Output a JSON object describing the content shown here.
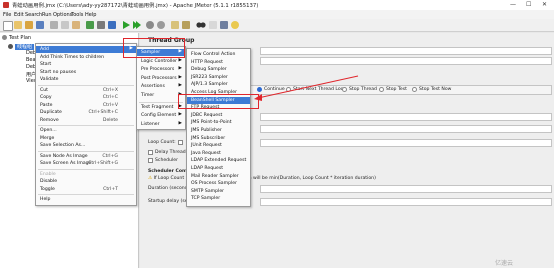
{
  "window": {
    "title": "青蛙动画用例.jmx (C:\\Users\\ady-yy287172\\青蛙动画用例.jmx) - Apache JMeter (5.1.1 r1855137)",
    "minimize": "—",
    "maximize": "☐",
    "close": "✕"
  },
  "menubar": [
    "File",
    "Edit",
    "Search",
    "Run",
    "Options",
    "Tools",
    "Help"
  ],
  "tree": {
    "root": "Test Plan",
    "group": "线程组",
    "children": [
      "Deb",
      "Bea",
      "Deb",
      "用户",
      "View"
    ]
  },
  "thread_group_tab": "Thread Group",
  "context_menu": {
    "items": [
      {
        "label": "Add",
        "shortcut": "",
        "arrow": true,
        "highlighted": true
      },
      {
        "label": "Add Think Times to children",
        "shortcut": ""
      },
      {
        "label": "Start",
        "shortcut": ""
      },
      {
        "label": "Start no pauses",
        "shortcut": ""
      },
      {
        "label": "Validate",
        "shortcut": ""
      },
      {
        "label": "Cut",
        "shortcut": "Ctrl+X"
      },
      {
        "label": "Copy",
        "shortcut": "Ctrl+C"
      },
      {
        "label": "Paste",
        "shortcut": "Ctrl+V"
      },
      {
        "label": "Duplicate",
        "shortcut": "Ctrl+Shift+C"
      },
      {
        "label": "Remove",
        "shortcut": "Delete"
      },
      {
        "label": "Open...",
        "shortcut": ""
      },
      {
        "label": "Merge",
        "shortcut": ""
      },
      {
        "label": "Save Selection As...",
        "shortcut": ""
      },
      {
        "label": "Save Node As Image",
        "shortcut": "Ctrl+G"
      },
      {
        "label": "Save Screen As Image",
        "shortcut": "Ctrl+Shift+G"
      },
      {
        "label": "Enable",
        "shortcut": "",
        "disabled": true
      },
      {
        "label": "Disable",
        "shortcut": ""
      },
      {
        "label": "Toggle",
        "shortcut": "Ctrl+T"
      },
      {
        "label": "Help",
        "shortcut": ""
      }
    ]
  },
  "add_submenu": {
    "items": [
      {
        "label": "Sampler",
        "highlighted": true
      },
      {
        "label": "Logic Controller"
      },
      {
        "label": "Pre Processors"
      },
      {
        "label": "Post Processors"
      },
      {
        "label": "Assertions"
      },
      {
        "label": "Timer"
      },
      {
        "label": "Test Fragment"
      },
      {
        "label": "Config Element"
      },
      {
        "label": "Listener"
      }
    ]
  },
  "sampler_submenu": {
    "items": [
      {
        "label": "Flow Control Action"
      },
      {
        "label": "HTTP Request"
      },
      {
        "label": "Debug Sampler"
      },
      {
        "label": "JSR223 Sampler"
      },
      {
        "label": "AJP/1.3 Sampler"
      },
      {
        "label": "Access Log Sampler"
      },
      {
        "label": "BeanShell Sampler",
        "highlighted": true
      },
      {
        "label": "FTP Request"
      },
      {
        "label": "JDBC Request"
      },
      {
        "label": "JMS Point-to-Point"
      },
      {
        "label": "JMS Publisher"
      },
      {
        "label": "JMS Subscriber"
      },
      {
        "label": "JUnit Request"
      },
      {
        "label": "Java Request"
      },
      {
        "label": "LDAP Extended Request"
      },
      {
        "label": "LDAP Request"
      },
      {
        "label": "Mail Reader Sampler"
      },
      {
        "label": "OS Process Sampler"
      },
      {
        "label": "SMTP Sampler"
      },
      {
        "label": "TCP Sampler"
      }
    ]
  },
  "thread_group_panel": {
    "on_error_options": [
      "Continue",
      "Start Next Thread Loop",
      "Stop Thread",
      "Stop Test",
      "Stop Test Now"
    ],
    "rampup_label": "Ramp-Up Period (",
    "loop_label": "Loop Count:",
    "loop_forever": "Forever",
    "delay_label": "Delay Thread c",
    "scheduler_label": "Scheduler",
    "scheduler_config": "Scheduler Configur",
    "warning": "If Loop Count is not -1 or Forever, duration will be min(Duration, Loop Count * iteration duration)",
    "duration_label": "Duration (seconds)",
    "startup_label": "Startup delay (seco"
  },
  "watermark": "亿速云"
}
